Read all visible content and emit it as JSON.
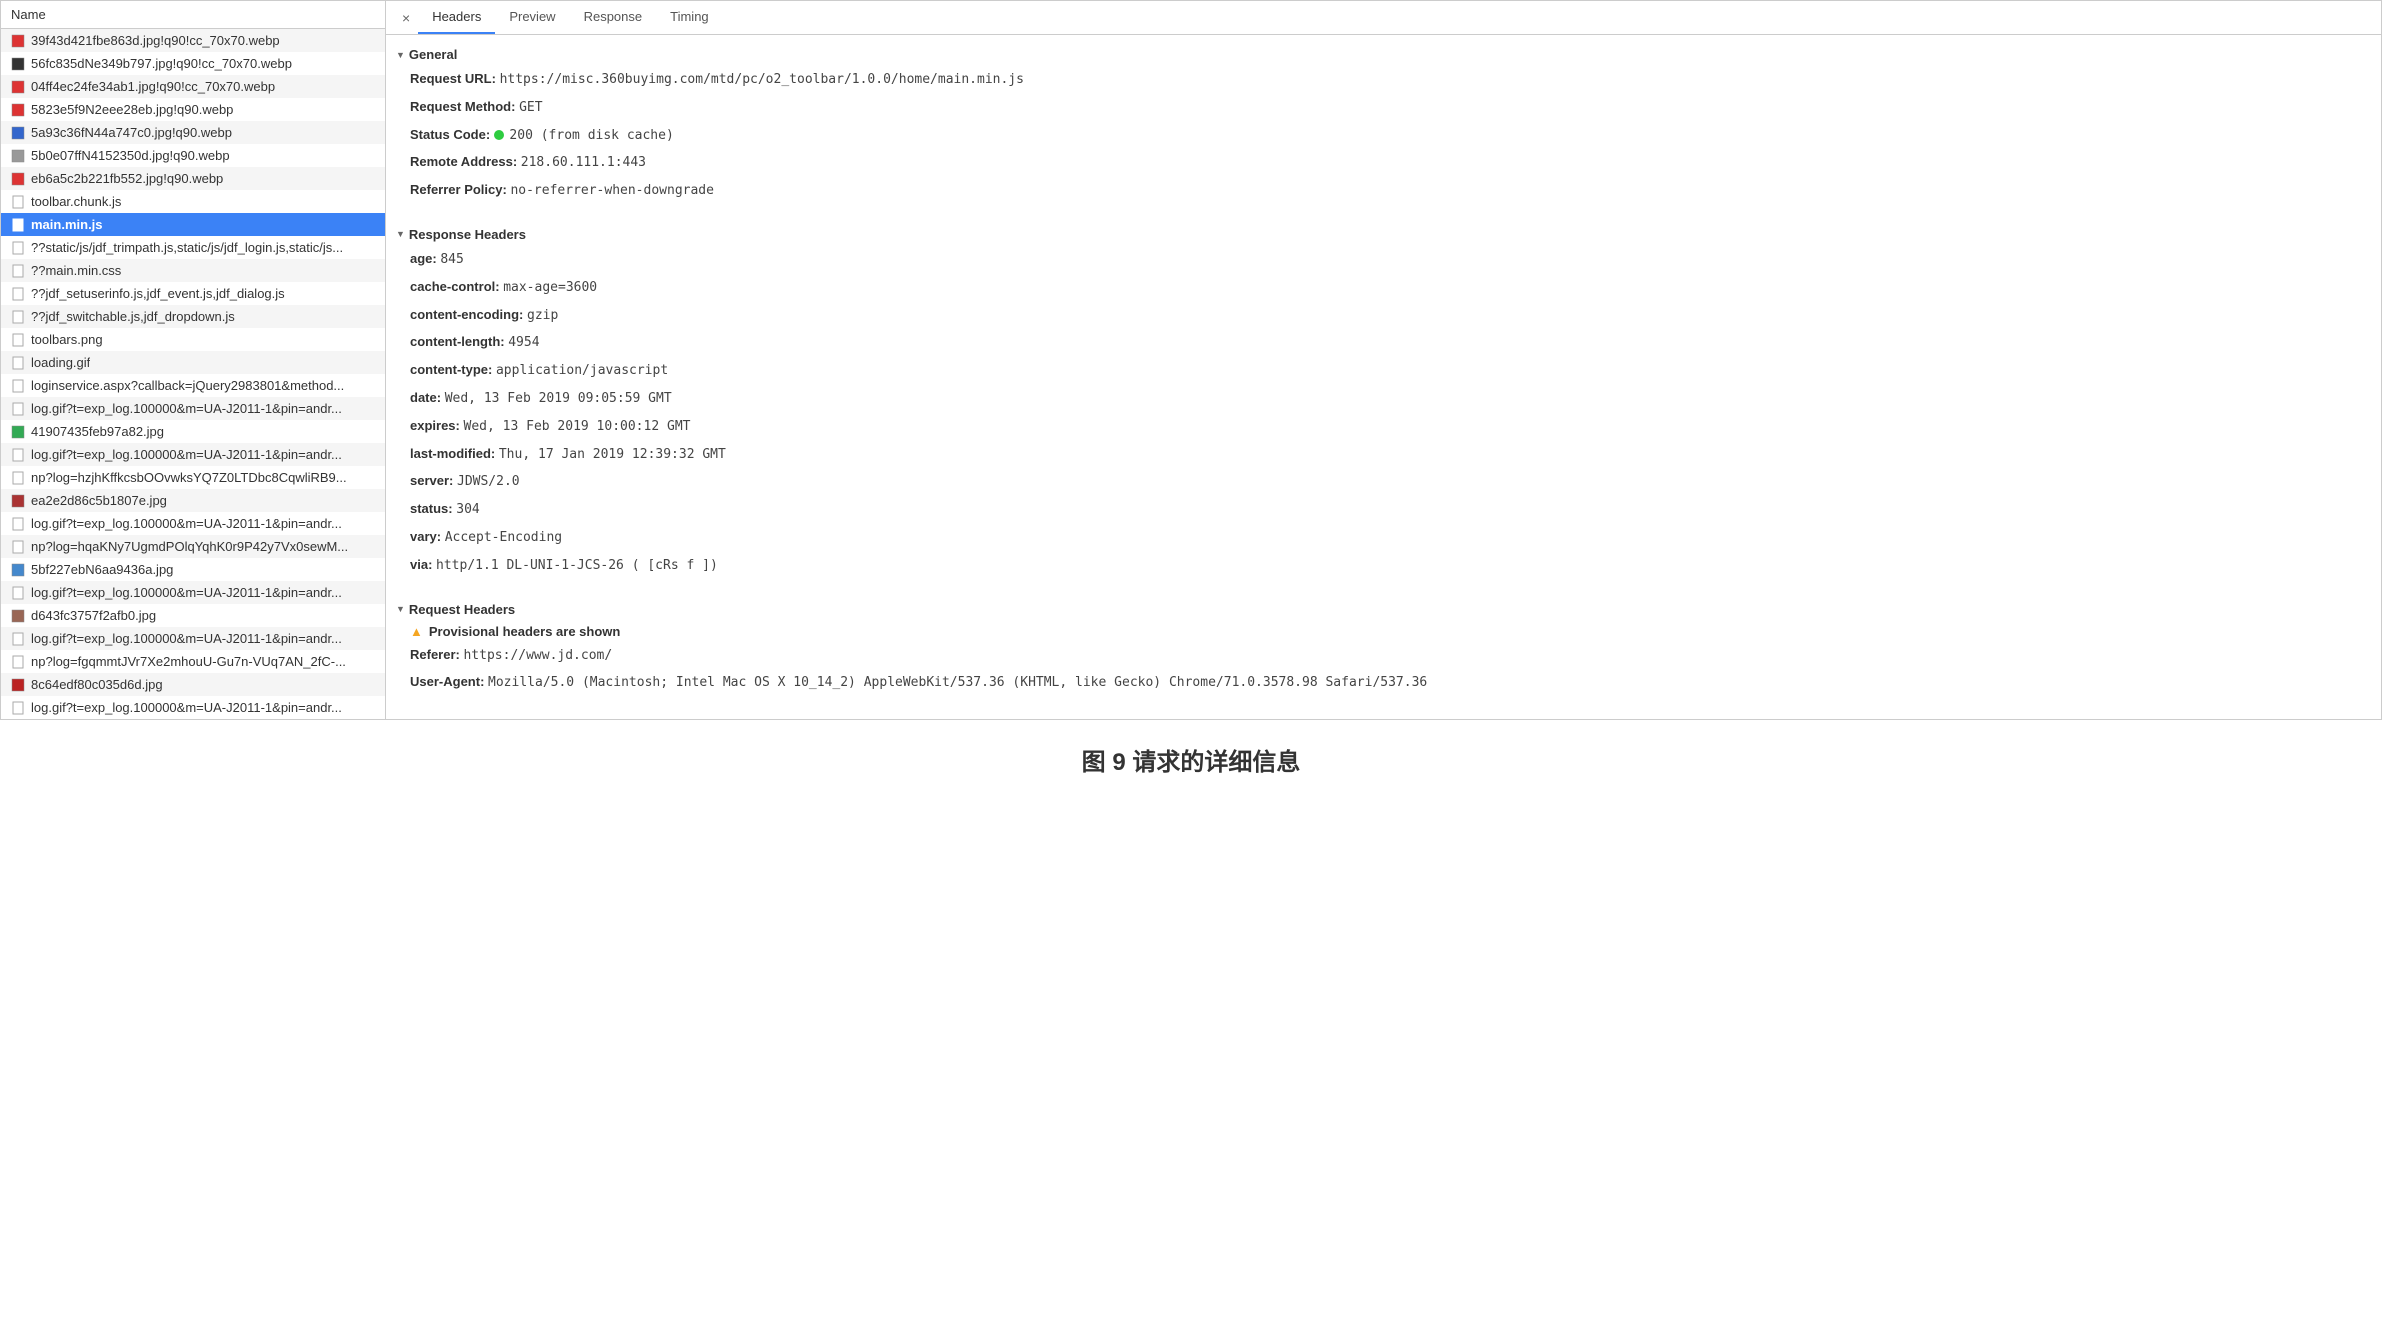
{
  "caption": "图 9 请求的详细信息",
  "left": {
    "header": "Name",
    "files": [
      {
        "name": "39f43d421fbe863d.jpg!q90!cc_70x70.webp",
        "icon": "img-red"
      },
      {
        "name": "56fc835dNe349b797.jpg!q90!cc_70x70.webp",
        "icon": "img-dark"
      },
      {
        "name": "04ff4ec24fe34ab1.jpg!q90!cc_70x70.webp",
        "icon": "img-red"
      },
      {
        "name": "5823e5f9N2eee28eb.jpg!q90.webp",
        "icon": "img-red"
      },
      {
        "name": "5a93c36fN44a747c0.jpg!q90.webp",
        "icon": "img-blue"
      },
      {
        "name": "5b0e07ffN4152350d.jpg!q90.webp",
        "icon": "img-gray"
      },
      {
        "name": "eb6a5c2b221fb552.jpg!q90.webp",
        "icon": "img-red"
      },
      {
        "name": "toolbar.chunk.js",
        "icon": "file"
      },
      {
        "name": "main.min.js",
        "icon": "file-sel",
        "selected": true
      },
      {
        "name": "??static/js/jdf_trimpath.js,static/js/jdf_login.js,static/js...",
        "icon": "file"
      },
      {
        "name": "??main.min.css",
        "icon": "file"
      },
      {
        "name": "??jdf_setuserinfo.js,jdf_event.js,jdf_dialog.js",
        "icon": "file"
      },
      {
        "name": "??jdf_switchable.js,jdf_dropdown.js",
        "icon": "file"
      },
      {
        "name": "toolbars.png",
        "icon": "file"
      },
      {
        "name": "loading.gif",
        "icon": "file"
      },
      {
        "name": "loginservice.aspx?callback=jQuery2983801&method...",
        "icon": "file"
      },
      {
        "name": "log.gif?t=exp_log.100000&m=UA-J2011-1&pin=andr...",
        "icon": "file"
      },
      {
        "name": "41907435feb97a82.jpg",
        "icon": "img-green"
      },
      {
        "name": "log.gif?t=exp_log.100000&m=UA-J2011-1&pin=andr...",
        "icon": "file"
      },
      {
        "name": "np?log=hzjhKffkcsbOOvwksYQ7Z0LTDbc8CqwliRB9...",
        "icon": "file-alt"
      },
      {
        "name": "ea2e2d86c5b1807e.jpg",
        "icon": "img-red2"
      },
      {
        "name": "log.gif?t=exp_log.100000&m=UA-J2011-1&pin=andr...",
        "icon": "file"
      },
      {
        "name": "np?log=hqaKNy7UgmdPOlqYqhK0r9P42y7Vx0sewM...",
        "icon": "file-alt"
      },
      {
        "name": "5bf227ebN6aa9436a.jpg",
        "icon": "img-blue2"
      },
      {
        "name": "log.gif?t=exp_log.100000&m=UA-J2011-1&pin=andr...",
        "icon": "file"
      },
      {
        "name": "d643fc3757f2afb0.jpg",
        "icon": "img-brown"
      },
      {
        "name": "log.gif?t=exp_log.100000&m=UA-J2011-1&pin=andr...",
        "icon": "file"
      },
      {
        "name": "np?log=fgqmmtJVr7Xe2mhouU-Gu7n-VUq7AN_2fC-...",
        "icon": "file-alt"
      },
      {
        "name": "8c64edf80c035d6d.jpg",
        "icon": "img-red3"
      },
      {
        "name": "log.gif?t=exp_log.100000&m=UA-J2011-1&pin=andr...",
        "icon": "file"
      }
    ]
  },
  "right": {
    "tabs": [
      "Headers",
      "Preview",
      "Response",
      "Timing"
    ],
    "active_tab": 0,
    "sections": {
      "general": {
        "title": "General",
        "rows": [
          {
            "k": "Request URL:",
            "v": "https://misc.360buyimg.com/mtd/pc/o2_toolbar/1.0.0/home/main.min.js"
          },
          {
            "k": "Request Method:",
            "v": "GET"
          },
          {
            "k": "Status Code:",
            "v": "200  (from disk cache)",
            "status": true
          },
          {
            "k": "Remote Address:",
            "v": "218.60.111.1:443"
          },
          {
            "k": "Referrer Policy:",
            "v": "no-referrer-when-downgrade"
          }
        ]
      },
      "response": {
        "title": "Response Headers",
        "rows": [
          {
            "k": "age:",
            "v": "845"
          },
          {
            "k": "cache-control:",
            "v": "max-age=3600"
          },
          {
            "k": "content-encoding:",
            "v": "gzip"
          },
          {
            "k": "content-length:",
            "v": "4954"
          },
          {
            "k": "content-type:",
            "v": "application/javascript"
          },
          {
            "k": "date:",
            "v": "Wed, 13 Feb 2019 09:05:59 GMT"
          },
          {
            "k": "expires:",
            "v": "Wed, 13 Feb 2019 10:00:12 GMT"
          },
          {
            "k": "last-modified:",
            "v": "Thu, 17 Jan 2019 12:39:32 GMT"
          },
          {
            "k": "server:",
            "v": "JDWS/2.0"
          },
          {
            "k": "status:",
            "v": "304"
          },
          {
            "k": "vary:",
            "v": "Accept-Encoding"
          },
          {
            "k": "via:",
            "v": "http/1.1 DL-UNI-1-JCS-26 ( [cRs f ])"
          }
        ]
      },
      "request": {
        "title": "Request Headers",
        "warning": "Provisional headers are shown",
        "rows": [
          {
            "k": "Referer:",
            "v": "https://www.jd.com/"
          },
          {
            "k": "User-Agent:",
            "v": "Mozilla/5.0 (Macintosh; Intel Mac OS X 10_14_2) AppleWebKit/537.36 (KHTML, like Gecko) Chrome/71.0.3578.98 Safari/537.36"
          }
        ]
      }
    }
  },
  "icon_colors": {
    "img-red": "#d33",
    "img-dark": "#333",
    "img-blue": "#36c",
    "img-gray": "#999",
    "img-green": "#3a5",
    "img-red2": "#a33",
    "img-blue2": "#48c",
    "img-brown": "#965",
    "img-red3": "#b22",
    "file": "#ccc",
    "file-sel": "#fff",
    "file-alt": "#9bd"
  }
}
